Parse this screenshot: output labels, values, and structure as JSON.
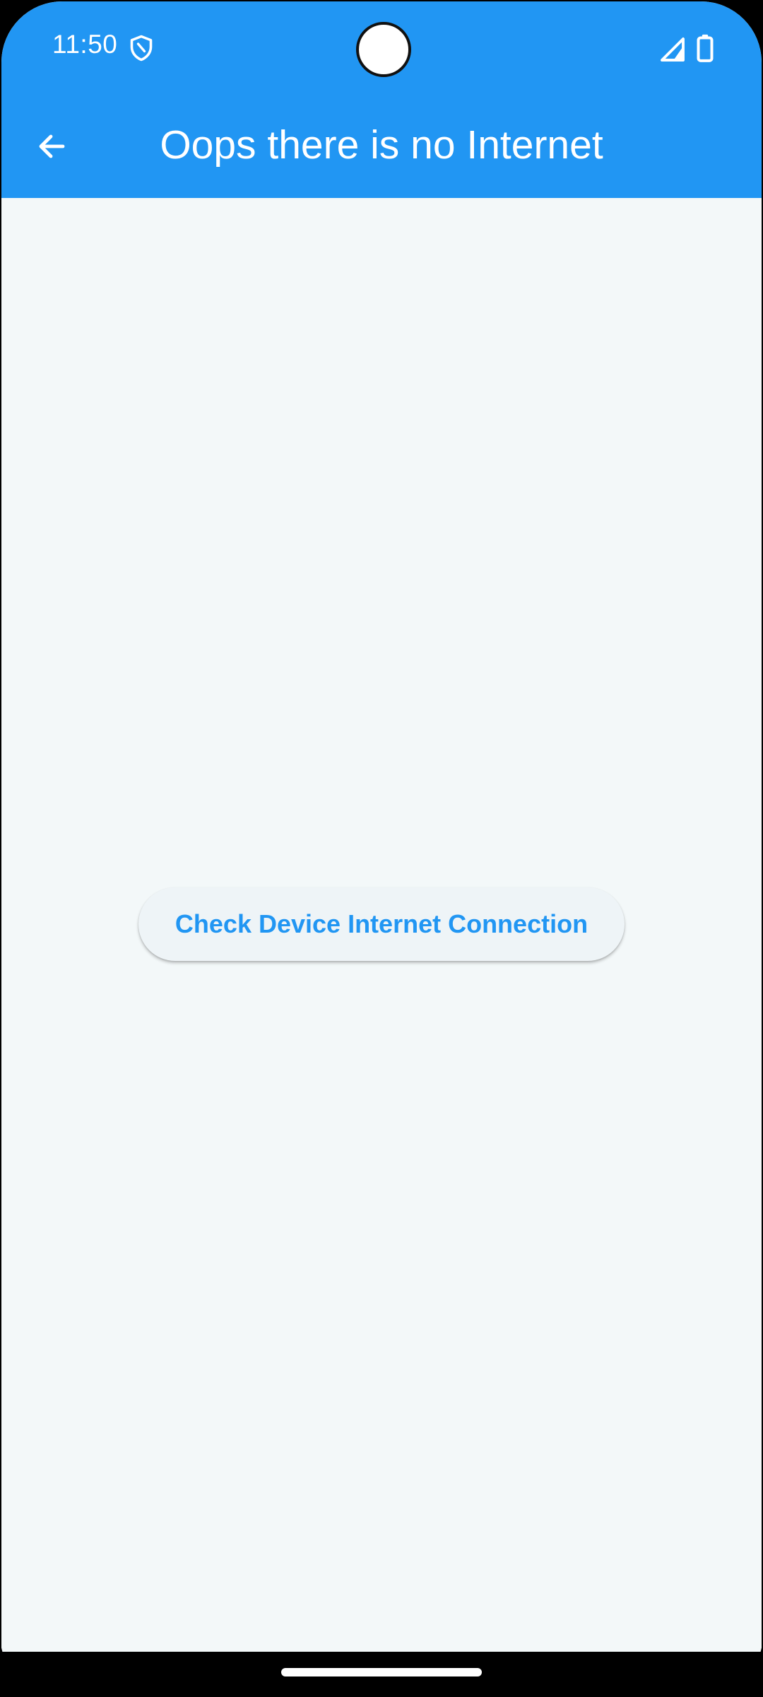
{
  "status_bar": {
    "time": "11:50",
    "icons": [
      "shield-icon",
      "signal-icon",
      "battery-icon"
    ]
  },
  "app_bar": {
    "back_icon": "arrow-back-icon",
    "title": "Oops there is no Internet"
  },
  "main": {
    "check_button_label": "Check Device Internet Connection"
  },
  "colors": {
    "primary": "#2196F3",
    "background": "#F3F8F9",
    "button_background": "#EEF4F7",
    "on_primary": "#FFFFFF"
  }
}
